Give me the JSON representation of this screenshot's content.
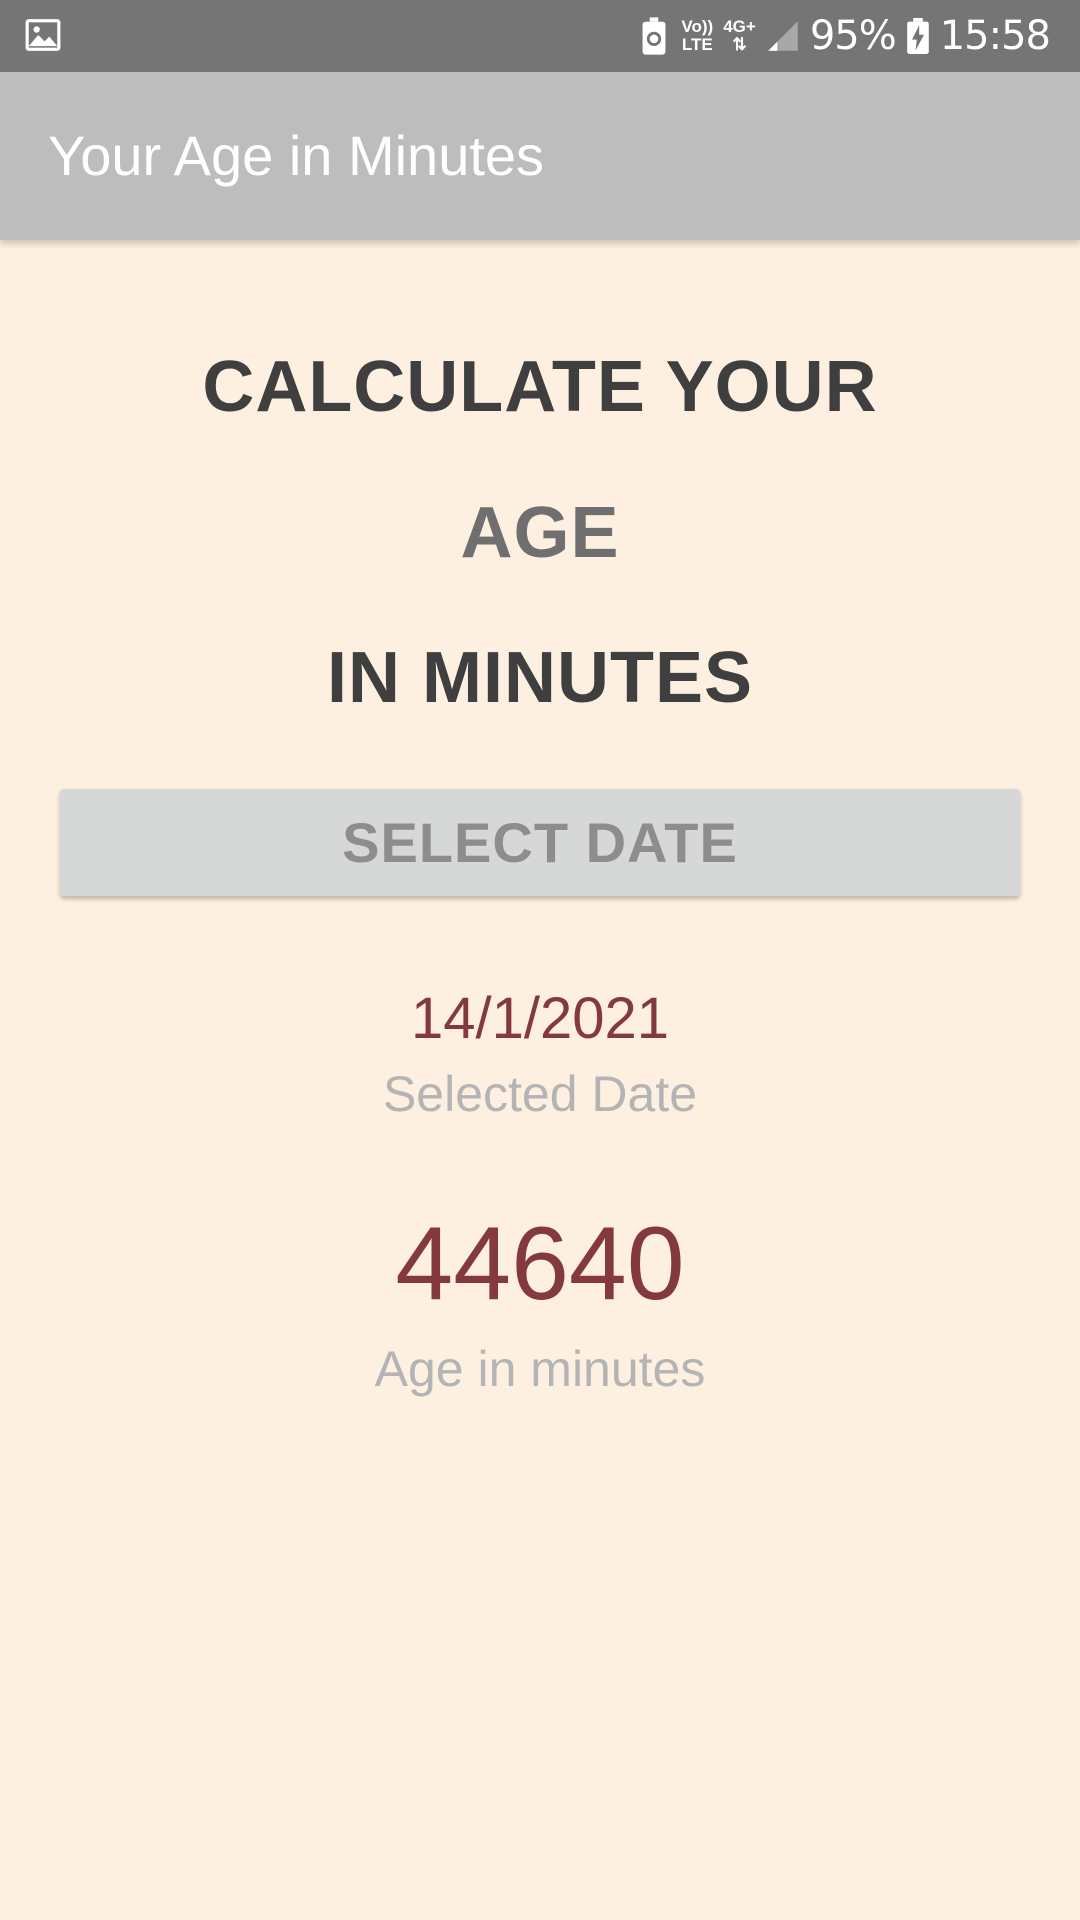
{
  "status_bar": {
    "left_icon": "image-notification-icon",
    "icons": [
      "battery-saver-icon",
      "volte-icon",
      "network-4g-icon",
      "signal-icon",
      "battery-charging-icon"
    ],
    "volte_line1": "Vo))",
    "volte_line2": "LTE",
    "network_label": "4G+",
    "battery_percent": "95%",
    "clock": "15:58"
  },
  "app_bar": {
    "title": "Your Age in Minutes"
  },
  "main": {
    "heading_line1": "CALCULATE YOUR",
    "heading_line2": "AGE",
    "heading_line3": "IN MINUTES",
    "select_button_label": "SELECT DATE",
    "selected_date_value": "14/1/2021",
    "selected_date_label": "Selected Date",
    "age_value": "44640",
    "age_label": "Age in minutes"
  },
  "colors": {
    "background": "#fdf0e1",
    "status_bar": "#757575",
    "app_bar": "#bdbdbd",
    "heading_dark": "#3f3f3f",
    "heading_mid": "#6f6f6f",
    "button_bg": "#d6d7d7",
    "button_text": "#8d8d8d",
    "value_color": "#84393f",
    "label_color": "#b4b4b4"
  }
}
